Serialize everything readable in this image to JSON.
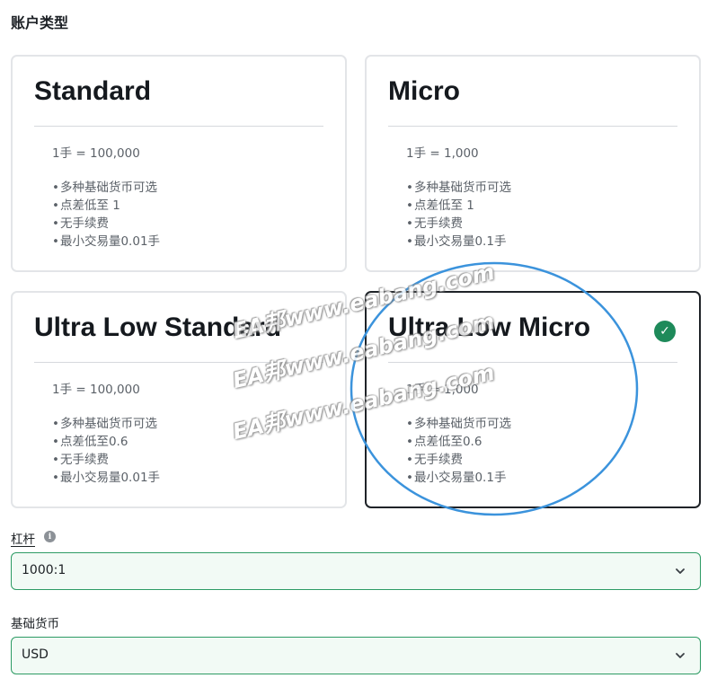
{
  "section_title": "账户类型",
  "cards": [
    {
      "title": "Standard",
      "lot": "1手 = 100,000",
      "features": [
        "多种基础货币可选",
        "点差低至 1",
        "无手续费",
        "最小交易量0.01手"
      ]
    },
    {
      "title": "Micro",
      "lot": "1手 = 1,000",
      "features": [
        "多种基础货币可选",
        "点差低至 1",
        "无手续费",
        "最小交易量0.1手"
      ]
    },
    {
      "title": "Ultra Low Standard",
      "lot": "1手 = 100,000",
      "features": [
        "多种基础货币可选",
        "点差低至0.6",
        "无手续费",
        "最小交易量0.01手"
      ]
    },
    {
      "title": "Ultra Low Micro",
      "lot": "1手 = 1,000",
      "features": [
        "多种基础货币可选",
        "点差低至0.6",
        "无手续费",
        "最小交易量0.1手"
      ],
      "selected": true
    }
  ],
  "leverage": {
    "label": "杠杆",
    "value": "1000:1"
  },
  "base_currency": {
    "label": "基础货币",
    "value": "USD"
  },
  "watermark_text": "EA邦www.eabang.com",
  "colors": {
    "selected_check": "#1e8a5a",
    "select_border": "#2d9b64",
    "annotation_circle": "#3b93dc"
  }
}
